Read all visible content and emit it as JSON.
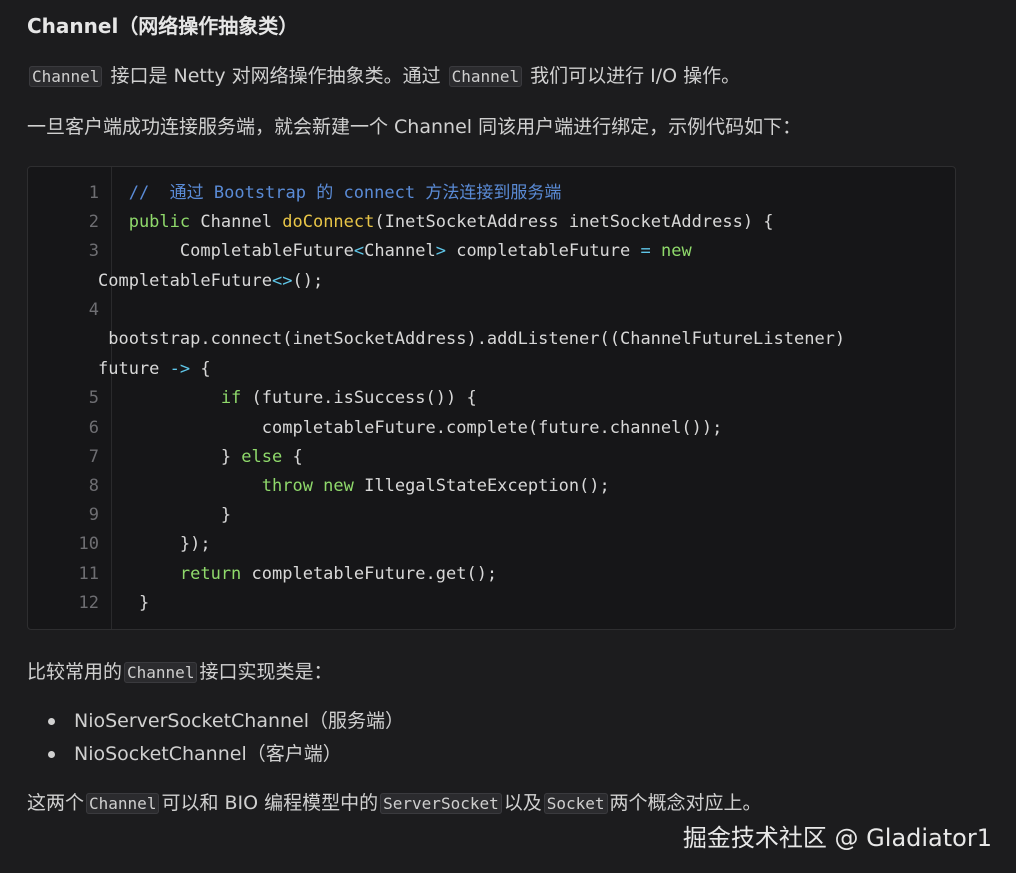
{
  "heading": "Channel（网络操作抽象类）",
  "para1": {
    "code1": "Channel",
    "text1": " 接口是 Netty 对网络操作抽象类。通过 ",
    "code2": "Channel",
    "text2": " 我们可以进行 I/O 操作。"
  },
  "para2": "一旦客户端成功连接服务端，就会新建一个 Channel 同该用户端进行绑定，示例代码如下：",
  "code": {
    "line_numbers": [
      "1",
      "2",
      "3",
      "4",
      "5",
      "6",
      "7",
      "8",
      "9",
      "10",
      "11",
      "12"
    ],
    "l1_comment": "   //  通过 Bootstrap 的 connect 方法连接到服务端",
    "l2_kw": "   public",
    "l2_type": " Channel ",
    "l2_fn": "doConnect",
    "l2_rest": "(InetSocketAddress inetSocketAddress) {",
    "l3_a": "        CompletableFuture",
    "l3_b": "<",
    "l3_c": "Channel",
    "l3_d": ">",
    "l3_e": " completableFuture ",
    "l3_f": "=",
    "l3_g": " new",
    "l3b_a": "CompletableFuture",
    "l3b_b": "<>",
    "l3b_c": "();",
    "l4a": " bootstrap.connect(inetSocketAddress).addListener((ChannelFutureListener)",
    "l4b_a": "future ",
    "l4b_b": "->",
    "l4b_c": " {",
    "l5_a": "            if",
    "l5_b": " (future.isSuccess()) {",
    "l6": "                completableFuture.complete(future.channel());",
    "l7_a": "            } ",
    "l7_b": "else",
    "l7_c": " {",
    "l8_a": "                throw",
    "l8_b": " new",
    "l8_c": " IllegalStateException();",
    "l9": "            }",
    "l10": "        });",
    "l11_a": "        return",
    "l11_b": " completableFuture.get();",
    "l12": "    }"
  },
  "para3": {
    "text1": "比较常用的",
    "code": "Channel",
    "text2": "接口实现类是："
  },
  "list": [
    "NioServerSocketChannel（服务端）",
    "NioSocketChannel（客户端）"
  ],
  "para4": {
    "text1": "这两个",
    "code1": "Channel",
    "text2": "可以和 BIO 编程模型中的",
    "code2": "ServerSocket",
    "text3": "以及",
    "code3": "Socket",
    "text4": "两个概念对应上。"
  },
  "watermark": "掘金技术社区 @ Gladiator1",
  "colors": {
    "background": "#1c1c1e",
    "code_background": "#161618",
    "comment": "#5a8bd6",
    "keyword": "#8fd96b",
    "function": "#e8c547",
    "operator": "#5fc6e8"
  }
}
